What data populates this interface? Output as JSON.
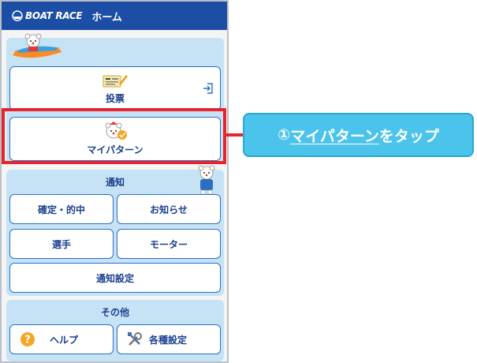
{
  "header": {
    "logo_text": "BOAT RACE",
    "title": "ホーム"
  },
  "vote": {
    "label": "投票"
  },
  "mypattern": {
    "label": "マイパターン"
  },
  "notification": {
    "title": "通知",
    "buttons": [
      "確定・的中",
      "お知らせ",
      "選手",
      "モーター"
    ],
    "settings_label": "通知設定"
  },
  "other": {
    "title": "その他",
    "help_label": "ヘルプ",
    "settings_label": "各種設定"
  },
  "callout": {
    "prefix": "①",
    "emph": "マイパターン",
    "suffix": "をタップ"
  },
  "colors": {
    "header": "#1c4ea6",
    "panel": "#c6e3f6",
    "highlight": "#e8232c",
    "callout": "#4cc3ea"
  }
}
